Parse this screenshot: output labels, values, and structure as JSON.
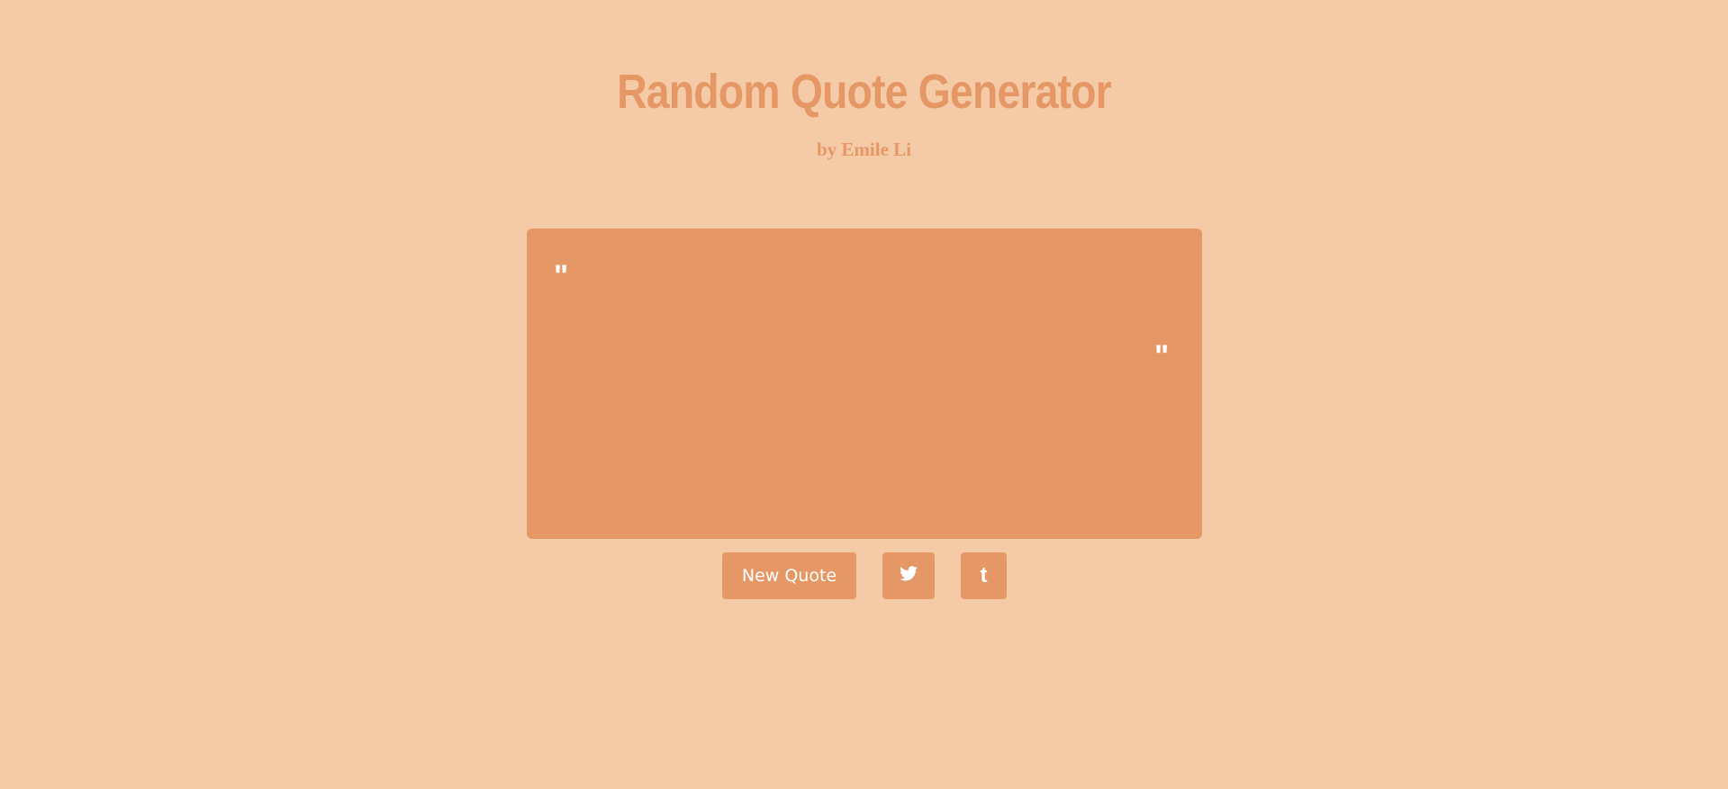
{
  "header": {
    "title": "Random Quote Generator",
    "byline": "by Emile Li"
  },
  "quote": {
    "open_mark": "\"",
    "close_mark": "\"",
    "text": "",
    "author": ""
  },
  "buttons": {
    "new_quote_label": "New Quote",
    "twitter_icon": "twitter-icon",
    "tumblr_glyph": "t"
  },
  "colors": {
    "background": "#f5cba7",
    "accent": "#e59866",
    "text_on_accent": "#ffffff"
  }
}
